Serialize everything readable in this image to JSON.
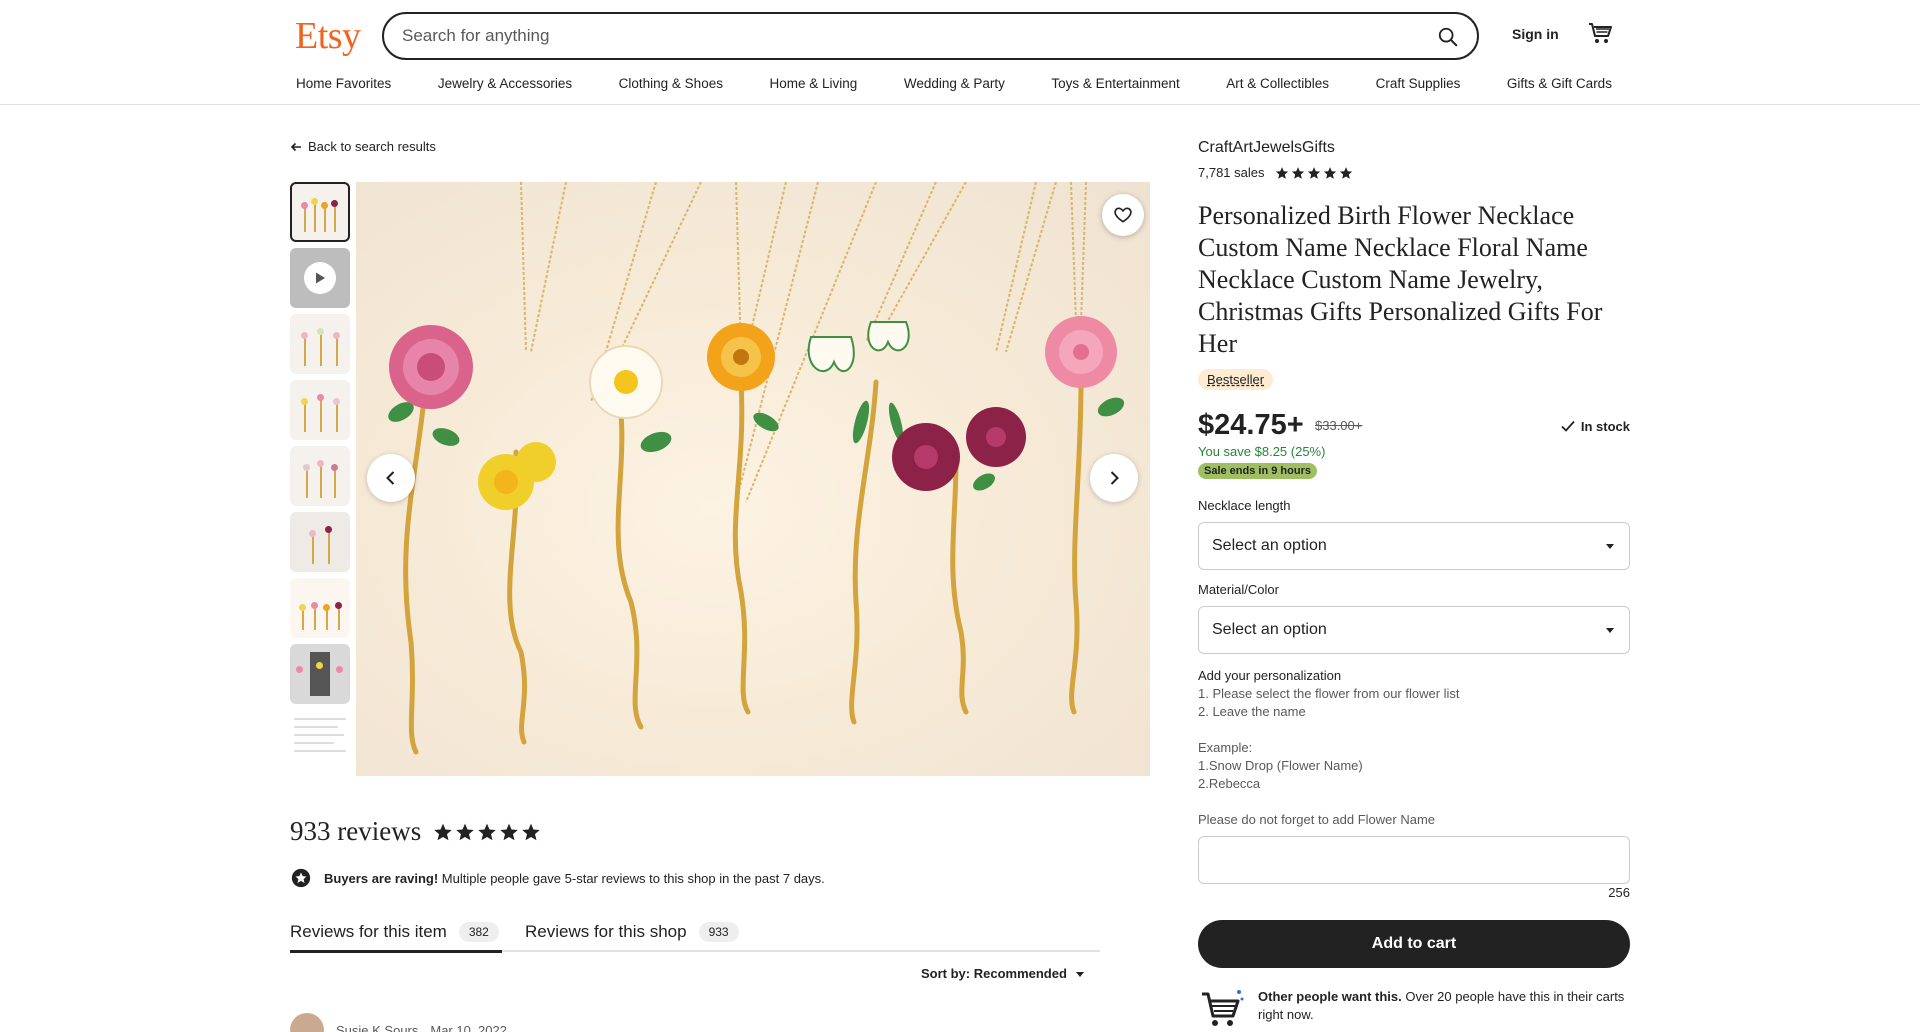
{
  "header": {
    "logo": "Etsy",
    "search_placeholder": "Search for anything",
    "sign_in": "Sign in",
    "nav": [
      "Home Favorites",
      "Jewelry & Accessories",
      "Clothing & Shoes",
      "Home & Living",
      "Wedding & Party",
      "Toys & Entertainment",
      "Art & Collectibles",
      "Craft Supplies",
      "Gifts & Gift Cards"
    ]
  },
  "back_link": "Back to search results",
  "gallery": {
    "thumbnail_count": 9,
    "active_index": 0,
    "has_video": true
  },
  "listing": {
    "shop_name": "CraftArtJewelsGifts",
    "sales": "7,781 sales",
    "shop_rating": 5,
    "title": "Personalized Birth Flower Necklace Custom Name Necklace Floral Name Necklace Custom Name Jewelry, Christmas Gifts Personalized Gifts For Her",
    "badge": "Bestseller",
    "price": "$24.75+",
    "original_price": "$33.00+",
    "stock": "In stock",
    "savings": "You save $8.25 (25%)",
    "sale_ends": "Sale ends in 9 hours",
    "necklace_length_label": "Necklace length",
    "necklace_length_value": "Select an option",
    "material_label": "Material/Color",
    "material_value": "Select an option",
    "personalization_heading": "Add your personalization",
    "personalization_lines": [
      "1. Please select the flower from our flower list",
      "2. Leave the name",
      "",
      "Example:",
      "1.Snow Drop (Flower Name)",
      "2.Rebecca",
      "",
      "Please do not forget to add Flower Name"
    ],
    "char_counter": "256",
    "add_to_cart": "Add to cart",
    "others_bold": "Other people want this.",
    "others_rest": " Over 20 people have this in their carts right now."
  },
  "reviews": {
    "count": "933 reviews",
    "rating": 5,
    "raving_bold": "Buyers are raving!",
    "raving_rest": " Multiple people gave 5-star reviews to this shop in the past 7 days.",
    "tab_item": "Reviews for this item",
    "tab_item_count": "382",
    "tab_shop": "Reviews for this shop",
    "tab_shop_count": "933",
    "sort_label": "Sort by: Recommended",
    "first_reviewer": "Susie K Sours",
    "first_review_date": "Mar 10, 2022"
  },
  "colors": {
    "brand": "#f1641e",
    "savings": "#258635",
    "sale_badge": "#9ec063",
    "bestseller_badge": "#fdebd2",
    "button": "#222222"
  }
}
